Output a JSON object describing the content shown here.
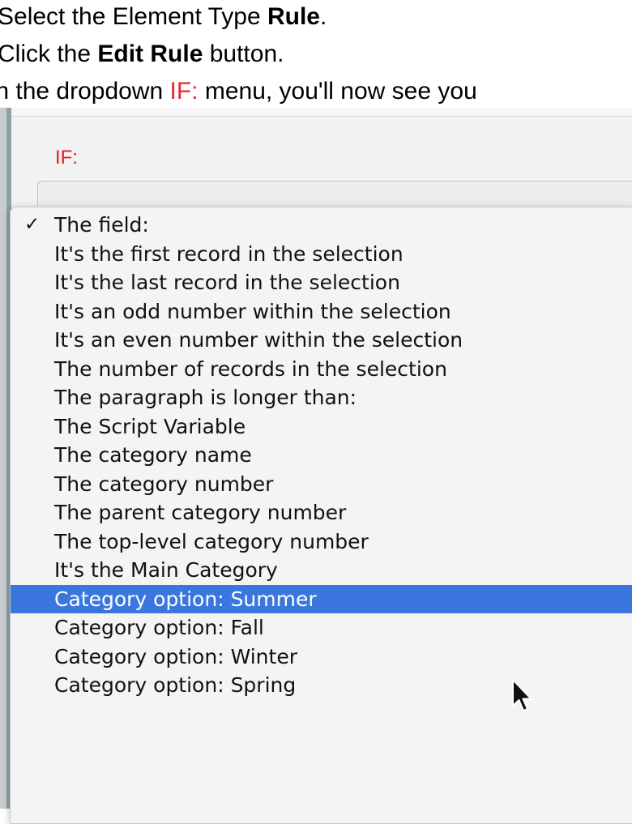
{
  "instructions": {
    "line1_prefix": "Select the Element Type ",
    "line1_bold": "Rule",
    "line1_suffix": ".",
    "line2_prefix": "Click the ",
    "line2_bold": "Edit Rule",
    "line2_suffix": " button.",
    "line3_prefix": "In the dropdown ",
    "line3_red": "IF:",
    "line3_suffix": " menu, you'll now see you"
  },
  "panel": {
    "if_label": "IF:"
  },
  "menu": {
    "checkmark": "✓",
    "items": [
      {
        "label": "The field:",
        "checked": true,
        "selected": false
      },
      {
        "label": "It's the first record in the selection",
        "checked": false,
        "selected": false
      },
      {
        "label": "It's the last record in the selection",
        "checked": false,
        "selected": false
      },
      {
        "label": "It's an odd number within the selection",
        "checked": false,
        "selected": false
      },
      {
        "label": "It's an even number within the selection",
        "checked": false,
        "selected": false
      },
      {
        "label": "The number of records in the selection",
        "checked": false,
        "selected": false
      },
      {
        "label": "The paragraph is longer than:",
        "checked": false,
        "selected": false
      },
      {
        "label": "The Script Variable",
        "checked": false,
        "selected": false
      },
      {
        "label": "The category name",
        "checked": false,
        "selected": false
      },
      {
        "label": "The category number",
        "checked": false,
        "selected": false
      },
      {
        "label": "The parent category number",
        "checked": false,
        "selected": false
      },
      {
        "label": "The top-level category number",
        "checked": false,
        "selected": false
      },
      {
        "label": "It's the Main Category",
        "checked": false,
        "selected": false
      },
      {
        "label": "Category option: Summer",
        "checked": false,
        "selected": true
      },
      {
        "label": "Category option: Fall",
        "checked": false,
        "selected": false
      },
      {
        "label": "Category option: Winter",
        "checked": false,
        "selected": false
      },
      {
        "label": "Category option: Spring",
        "checked": false,
        "selected": false
      }
    ]
  },
  "colors": {
    "highlight": "#3a76de",
    "if_red": "#e02020"
  },
  "icons": {
    "pointer": "mouse-pointer-icon",
    "check": "checkmark-icon"
  }
}
